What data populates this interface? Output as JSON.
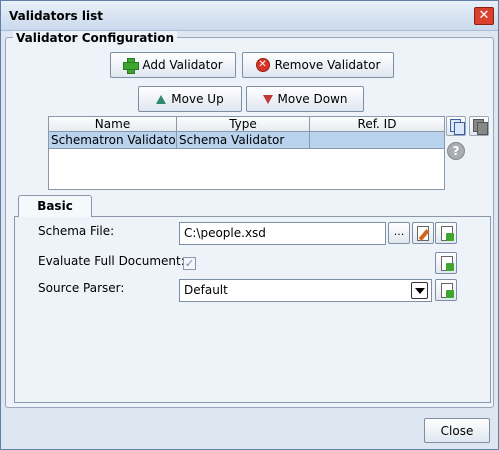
{
  "window": {
    "title": "Validators list"
  },
  "group": {
    "title": "Validator Configuration"
  },
  "toolbar": {
    "add_label": "Add Validator",
    "remove_label": "Remove Validator",
    "move_up_label": "Move Up",
    "move_down_label": "Move Down"
  },
  "table": {
    "headers": [
      "Name",
      "Type",
      "Ref. ID"
    ],
    "rows": [
      {
        "name": "Schematron Validator",
        "type": "Schema Validator",
        "ref_id": ""
      }
    ]
  },
  "tabs": {
    "basic": "Basic"
  },
  "form": {
    "schema_file_label": "Schema File:",
    "schema_file_value": "C:\\people.xsd",
    "browse_label": "...",
    "evaluate_label": "Evaluate Full Document:",
    "evaluate_checked": true,
    "source_parser_label": "Source Parser:",
    "source_parser_value": "Default"
  },
  "footer": {
    "close_label": "Close"
  },
  "icons": {
    "add": "add-plus-icon",
    "remove": "remove-x-icon",
    "up": "arrow-up-icon",
    "down": "arrow-down-icon",
    "copy": "copy-icon",
    "help": "help-icon",
    "edit": "edit-icon",
    "new_doc": "new-document-icon"
  }
}
